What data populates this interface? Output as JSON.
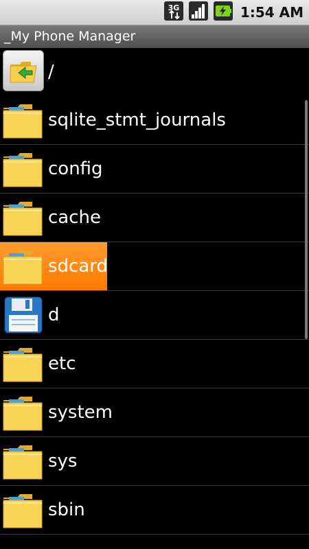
{
  "status_bar": {
    "network_label": "3G",
    "time": "1:54 AM"
  },
  "title_bar": {
    "title": "_My Phone Manager"
  },
  "path": {
    "current": "/"
  },
  "entries": [
    {
      "label": "sqlite_stmt_journals",
      "type": "folder",
      "selected": false
    },
    {
      "label": "config",
      "type": "folder",
      "selected": false
    },
    {
      "label": "cache",
      "type": "folder",
      "selected": false
    },
    {
      "label": "sdcard",
      "type": "folder",
      "selected": true
    },
    {
      "label": "d",
      "type": "file",
      "selected": false
    },
    {
      "label": "etc",
      "type": "folder",
      "selected": false
    },
    {
      "label": "system",
      "type": "folder",
      "selected": false
    },
    {
      "label": "sys",
      "type": "folder",
      "selected": false
    },
    {
      "label": "sbin",
      "type": "folder",
      "selected": false
    }
  ],
  "icons": {
    "folder": "folder-icon",
    "file": "floppy-disk-icon",
    "up": "folder-up-icon"
  },
  "colors": {
    "highlight": "#ff8a00",
    "folder_yellow": "#f6c431",
    "background": "#000000"
  }
}
